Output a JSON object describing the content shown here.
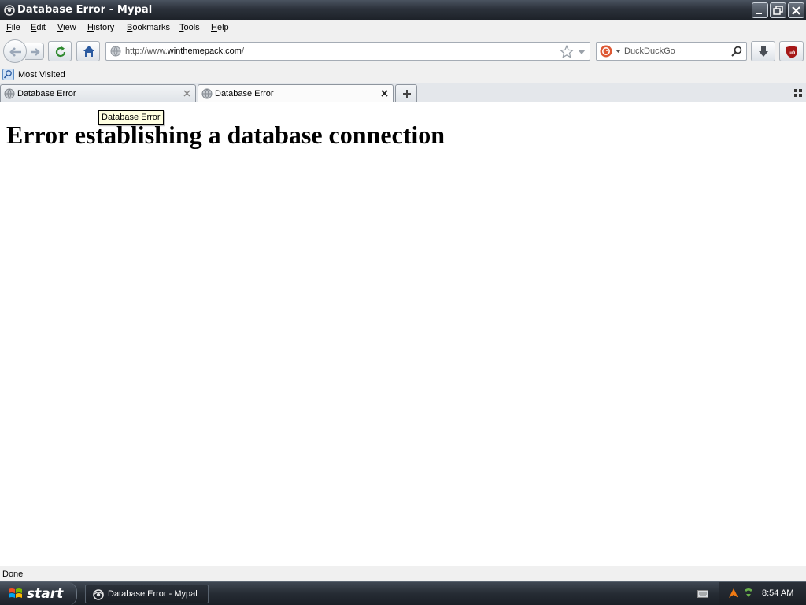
{
  "window": {
    "title": "Database Error - Mypal"
  },
  "menu": [
    {
      "label": "File",
      "key": "F",
      "rest": "ile"
    },
    {
      "label": "Edit",
      "key": "E",
      "rest": "dit"
    },
    {
      "label": "View",
      "key": "V",
      "rest": "iew"
    },
    {
      "label": "History",
      "key": "H",
      "rest": "istory"
    },
    {
      "label": "Bookmarks",
      "key": "B",
      "rest": "ookmarks"
    },
    {
      "label": "Tools",
      "key": "T",
      "rest": "ools"
    },
    {
      "label": "Help",
      "key": "H",
      "rest": "elp"
    }
  ],
  "navbar": {
    "url_prefix": "http://www.",
    "url_domain": "winthemepack.com",
    "url_suffix": "/",
    "search_placeholder": "DuckDuckGo"
  },
  "bookmarks": {
    "item": "Most Visited"
  },
  "tabs": [
    {
      "label": "Database Error",
      "active": false
    },
    {
      "label": "Database Error",
      "active": true
    }
  ],
  "tooltip": "Database Error",
  "content": {
    "heading": "Error establishing a database connection"
  },
  "status": "Done",
  "taskbar": {
    "start_label": "start",
    "task_label": "Database Error - Mypal",
    "clock": "8:54 AM"
  },
  "colors": {
    "titlebar": "#2c323b",
    "chrome": "#f0f0f0",
    "tooltip_bg": "#ffffe1"
  }
}
